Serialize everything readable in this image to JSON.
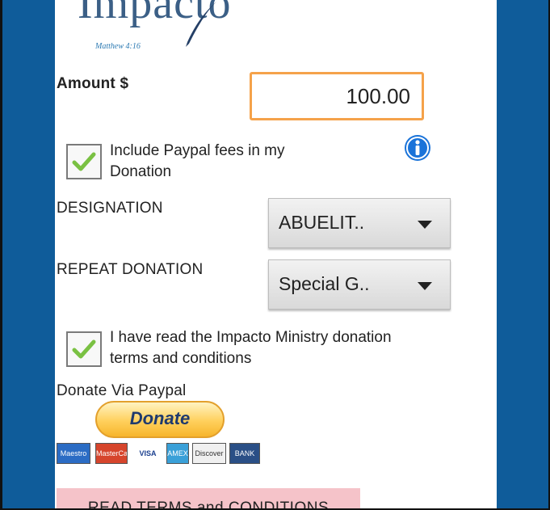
{
  "logo": {
    "word": "Impacto",
    "verse": "Matthew 4:16"
  },
  "amount": {
    "label": "Amount $",
    "value": "100.00"
  },
  "fees": {
    "checked": true,
    "label_line1": "Include Paypal fees in my",
    "label_line2": "Donation"
  },
  "designation": {
    "label": "DESIGNATION",
    "selected": "ABUELIT.."
  },
  "repeat": {
    "label": "REPEAT DONATION",
    "selected": "Special G.."
  },
  "terms": {
    "checked": true,
    "label_line1": "I have read the Impacto Ministry donation",
    "label_line2": "terms and conditions"
  },
  "paypal": {
    "label": "Donate Via Paypal",
    "button": "Donate"
  },
  "cards": [
    "Maestro",
    "MasterCard",
    "VISA",
    "AMEX",
    "Discover",
    "BANK"
  ],
  "read_terms_button": "READ TERMS and CONDITIONS",
  "colors": {
    "frame": "#0f5c9a",
    "accent_border": "#f5a24a",
    "check": "#7ac143",
    "info": "#1a73d9",
    "terms_button_bg": "#f5c3c9"
  },
  "icons": {
    "check": "checkmark-icon",
    "info": "info-icon",
    "caret": "caret-down-icon"
  }
}
